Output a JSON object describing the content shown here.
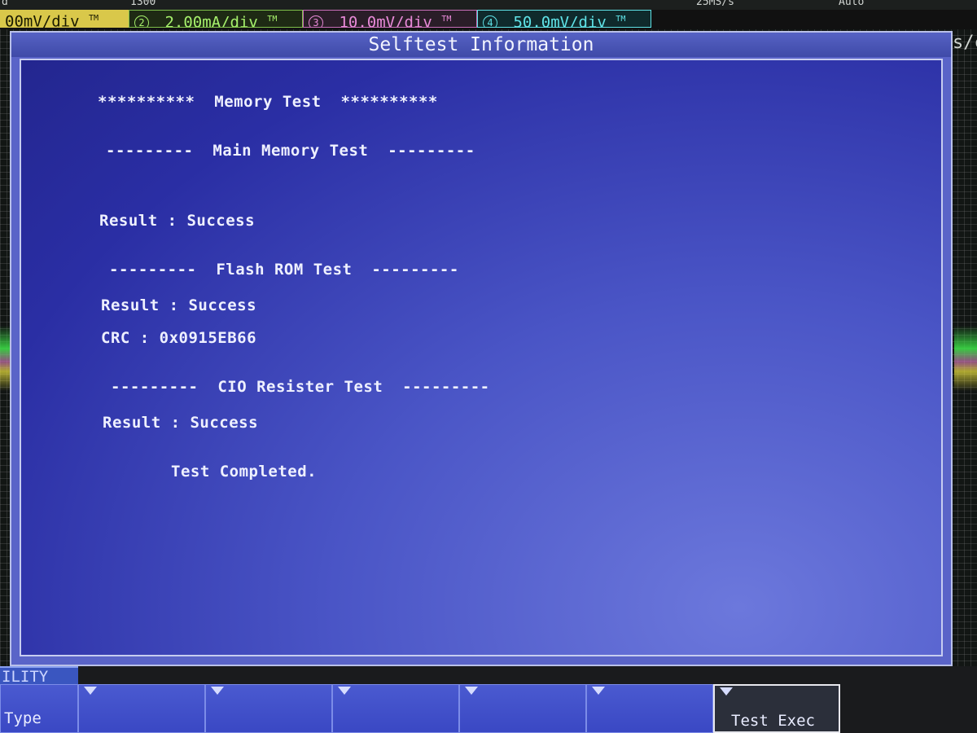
{
  "top_strip": {
    "left_fragment": "d",
    "center_fragment": "1300",
    "sample_rate": "25MS/s",
    "trigger_mode": "Auto"
  },
  "channels": [
    {
      "number": "",
      "scale": "00mV/div",
      "badge": "TM",
      "color": "#d9c84a"
    },
    {
      "number": "2",
      "scale": "2.00mA/div",
      "badge": "TM",
      "color": "#a6f06c"
    },
    {
      "number": "3",
      "scale": "10.0mV/div",
      "badge": "TM",
      "color": "#e88ad8"
    },
    {
      "number": "4",
      "scale": "50.0mV/div",
      "badge": "TM",
      "color": "#5fe2e6"
    }
  ],
  "right_edge_fragment": "s/c",
  "dialog": {
    "title": "Selftest Information",
    "lines": {
      "memory_header": "**********  Memory Test  **********",
      "main_memory_header": "---------  Main Memory Test  ---------",
      "main_memory_result": "Result : Success",
      "flash_header": "---------  Flash ROM Test  ---------",
      "flash_result": "Result : Success",
      "flash_crc": "CRC : 0x0915EB66",
      "cio_header": "---------  CIO Resister Test  ---------",
      "cio_result": "Result : Success",
      "completed": "Test Completed."
    }
  },
  "bottom": {
    "menu_tab": "ILITY",
    "softkeys": [
      {
        "label": "Type"
      },
      {
        "label": ""
      },
      {
        "label": ""
      },
      {
        "label": ""
      },
      {
        "label": ""
      },
      {
        "label": ""
      },
      {
        "label": "Test Exec"
      }
    ]
  }
}
